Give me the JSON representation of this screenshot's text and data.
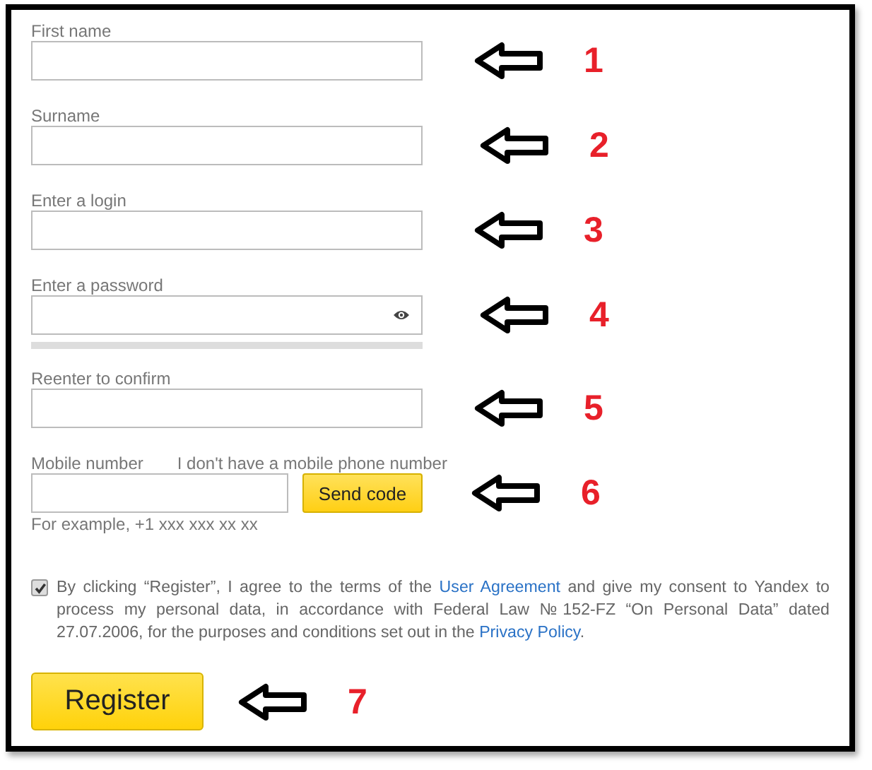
{
  "fields": [
    {
      "label": "First name",
      "kind": "text",
      "marker": "1"
    },
    {
      "label": "Surname",
      "kind": "text",
      "marker": "2"
    },
    {
      "label": "Enter a login",
      "kind": "text",
      "marker": "3"
    },
    {
      "label": "Enter a password",
      "kind": "password",
      "marker": "4",
      "strength": {
        "level": 0
      }
    },
    {
      "label": "Reenter to confirm",
      "kind": "text",
      "marker": "5"
    }
  ],
  "phone": {
    "label": "Mobile number",
    "alt_link": "I don't have a mobile phone number",
    "button": "Send code",
    "hint": "For example, +1 xxx xxx xx xx",
    "marker": "6"
  },
  "consent": {
    "checked": true,
    "parts": [
      {
        "kind": "text",
        "text": "By clicking “Register”, I agree to the terms of the "
      },
      {
        "kind": "link",
        "text": "User Agreement"
      },
      {
        "kind": "text",
        "text": " and give my consent to Yandex to process my personal data, in accordance with Federal Law №152-FZ “On Personal Data” dated 27.07.2006, for the purposes and conditions set out in the "
      },
      {
        "kind": "link",
        "text": "Privacy Policy"
      },
      {
        "kind": "text",
        "text": "."
      }
    ]
  },
  "register": {
    "label": "Register",
    "marker": "7"
  }
}
